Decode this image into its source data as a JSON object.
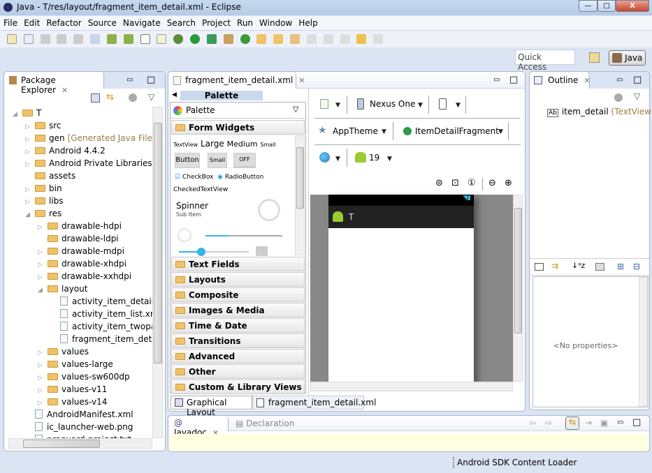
{
  "window": {
    "title": "Java - T/res/layout/fragment_item_detail.xml - Eclipse",
    "min": "—",
    "max": "□",
    "close": "X"
  },
  "menu": [
    "File",
    "Edit",
    "Refactor",
    "Source",
    "Navigate",
    "Search",
    "Project",
    "Run",
    "Window",
    "Help"
  ],
  "quick_access": {
    "placeholder": "Quick Access"
  },
  "perspective": {
    "label": "Java"
  },
  "package_explorer": {
    "title": "Package Explorer",
    "items": [
      {
        "label": "T",
        "level": 0,
        "expanded": true
      },
      {
        "label": "src",
        "level": 1
      },
      {
        "label": "gen",
        "suffix": "[Generated Java Files]",
        "level": 1
      },
      {
        "label": "Android 4.4.2",
        "level": 1
      },
      {
        "label": "Android Private Libraries",
        "level": 1
      },
      {
        "label": "assets",
        "level": 1,
        "leaf": true
      },
      {
        "label": "bin",
        "level": 1
      },
      {
        "label": "libs",
        "level": 1
      },
      {
        "label": "res",
        "level": 1,
        "expanded": true
      },
      {
        "label": "drawable-hdpi",
        "level": 2
      },
      {
        "label": "drawable-ldpi",
        "level": 2,
        "leaf": true
      },
      {
        "label": "drawable-mdpi",
        "level": 2
      },
      {
        "label": "drawable-xhdpi",
        "level": 2
      },
      {
        "label": "drawable-xxhdpi",
        "level": 2
      },
      {
        "label": "layout",
        "level": 2,
        "expanded": true
      },
      {
        "label": "activity_item_detail.xml",
        "level": 3,
        "file": true
      },
      {
        "label": "activity_item_list.xml",
        "level": 3,
        "file": true
      },
      {
        "label": "activity_item_twopane.xml",
        "level": 3,
        "file": true
      },
      {
        "label": "fragment_item_detail.xml",
        "level": 3,
        "file": true
      },
      {
        "label": "values",
        "level": 2
      },
      {
        "label": "values-large",
        "level": 2
      },
      {
        "label": "values-sw600dp",
        "level": 2
      },
      {
        "label": "values-v11",
        "level": 2
      },
      {
        "label": "values-v14",
        "level": 2
      },
      {
        "label": "AndroidManifest.xml",
        "level": 1,
        "file": true
      },
      {
        "label": "ic_launcher-web.png",
        "level": 1,
        "file": true
      },
      {
        "label": "proguard-project.txt",
        "level": 1,
        "file": true
      }
    ]
  },
  "editor": {
    "tab": "fragment_item_detail.xml",
    "palette": {
      "header": "Palette",
      "title": "Palette",
      "open_category": "Form Widgets",
      "widgets": {
        "textview": "TextView",
        "large": "Large",
        "medium": "Medium",
        "small": "Small",
        "button": "Button",
        "small_button": "Small",
        "toggle": "OFF",
        "checkbox": "CheckBox",
        "radio": "RadioButton",
        "checked_text": "CheckedTextView",
        "spinner": "Spinner",
        "sub_item": "Sub Item"
      },
      "categories": [
        "Text Fields",
        "Layouts",
        "Composite",
        "Images & Media",
        "Time & Date",
        "Transitions",
        "Advanced",
        "Other",
        "Custom & Library Views"
      ]
    },
    "config": {
      "device": "Nexus One",
      "theme": "AppTheme",
      "activity": "ItemDetailFragment",
      "api": "19"
    },
    "preview": {
      "app_title": "T"
    },
    "bottom_tabs": [
      "Graphical Layout",
      "fragment_item_detail.xml"
    ]
  },
  "outline": {
    "title": "Outline",
    "item": "item_detail",
    "item_type": "(TextView)",
    "properties_empty": "<No properties>"
  },
  "bottom": {
    "tabs": [
      "Javadoc",
      "Declaration"
    ]
  },
  "status": {
    "text": "Android SDK Content Loader"
  }
}
